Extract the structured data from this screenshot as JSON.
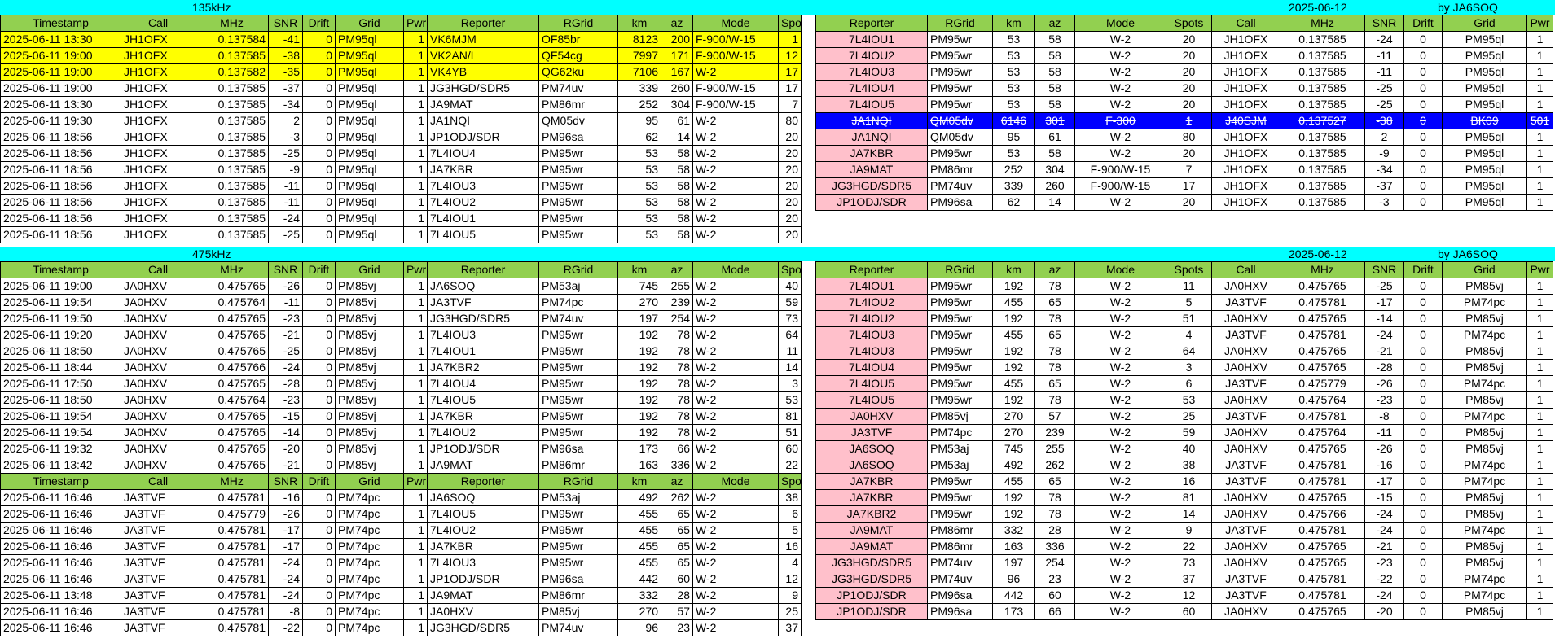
{
  "sections": {
    "s135": {
      "freq": "135kHz",
      "date": "2025-06-12",
      "by": "by JA6SOQ"
    },
    "s475": {
      "freq": "475kHz",
      "date": "2025-06-12",
      "by": "by JA6SOQ"
    }
  },
  "left_headers": [
    "Timestamp",
    "Call",
    "MHz",
    "SNR",
    "Drift",
    "Grid",
    "Pwr",
    "Reporter",
    "RGrid",
    "km",
    "az",
    "Mode",
    "Spots"
  ],
  "right_headers": [
    "Reporter",
    "RGrid",
    "km",
    "az",
    "Mode",
    "Spots",
    "Call",
    "MHz",
    "SNR",
    "Drift",
    "Grid",
    "Pwr"
  ],
  "colors": {
    "band": "#00ffff",
    "header": "#92d050",
    "highlight": "#ffff00",
    "reporter_pink": "#ffc0cb",
    "struck_row": "#0000ff"
  },
  "spots_135": [
    [
      "2025-06-11 13:30",
      "JH1OFX",
      "0.137584",
      "-41",
      "0",
      "PM95ql",
      "1",
      "VK6MJM",
      "OF85br",
      "8123",
      "200",
      "F-900/W-15",
      "1"
    ],
    [
      "2025-06-11 19:00",
      "JH1OFX",
      "0.137585",
      "-38",
      "0",
      "PM95ql",
      "1",
      "VK2AN/L",
      "QF54cg",
      "7997",
      "171",
      "F-900/W-15",
      "12"
    ],
    [
      "2025-06-11 19:00",
      "JH1OFX",
      "0.137582",
      "-35",
      "0",
      "PM95ql",
      "1",
      "VK4YB",
      "QG62ku",
      "7106",
      "167",
      "W-2",
      "17"
    ],
    [
      "2025-06-11 19:00",
      "JH1OFX",
      "0.137585",
      "-37",
      "0",
      "PM95ql",
      "1",
      "JG3HGD/SDR5",
      "PM74uv",
      "339",
      "260",
      "F-900/W-15",
      "17"
    ],
    [
      "2025-06-11 13:30",
      "JH1OFX",
      "0.137585",
      "-34",
      "0",
      "PM95ql",
      "1",
      "JA9MAT",
      "PM86mr",
      "252",
      "304",
      "F-900/W-15",
      "7"
    ],
    [
      "2025-06-11 19:30",
      "JH1OFX",
      "0.137585",
      "2",
      "0",
      "PM95ql",
      "1",
      "JA1NQI",
      "QM05dv",
      "95",
      "61",
      "W-2",
      "80"
    ],
    [
      "2025-06-11 18:56",
      "JH1OFX",
      "0.137585",
      "-3",
      "0",
      "PM95ql",
      "1",
      "JP1ODJ/SDR",
      "PM96sa",
      "62",
      "14",
      "W-2",
      "20"
    ],
    [
      "2025-06-11 18:56",
      "JH1OFX",
      "0.137585",
      "-25",
      "0",
      "PM95ql",
      "1",
      "7L4IOU4",
      "PM95wr",
      "53",
      "58",
      "W-2",
      "20"
    ],
    [
      "2025-06-11 18:56",
      "JH1OFX",
      "0.137585",
      "-9",
      "0",
      "PM95ql",
      "1",
      "JA7KBR",
      "PM95wr",
      "53",
      "58",
      "W-2",
      "20"
    ],
    [
      "2025-06-11 18:56",
      "JH1OFX",
      "0.137585",
      "-11",
      "0",
      "PM95ql",
      "1",
      "7L4IOU3",
      "PM95wr",
      "53",
      "58",
      "W-2",
      "20"
    ],
    [
      "2025-06-11 18:56",
      "JH1OFX",
      "0.137585",
      "-11",
      "0",
      "PM95ql",
      "1",
      "7L4IOU2",
      "PM95wr",
      "53",
      "58",
      "W-2",
      "20"
    ],
    [
      "2025-06-11 18:56",
      "JH1OFX",
      "0.137585",
      "-24",
      "0",
      "PM95ql",
      "1",
      "7L4IOU1",
      "PM95wr",
      "53",
      "58",
      "W-2",
      "20"
    ],
    [
      "2025-06-11 18:56",
      "JH1OFX",
      "0.137585",
      "-25",
      "0",
      "PM95ql",
      "1",
      "7L4IOU5",
      "PM95wr",
      "53",
      "58",
      "W-2",
      "20"
    ]
  ],
  "reporters_135": [
    [
      "7L4IOU1",
      "PM95wr",
      "53",
      "58",
      "W-2",
      "20",
      "JH1OFX",
      "0.137585",
      "-24",
      "0",
      "PM95ql",
      "1"
    ],
    [
      "7L4IOU2",
      "PM95wr",
      "53",
      "58",
      "W-2",
      "20",
      "JH1OFX",
      "0.137585",
      "-11",
      "0",
      "PM95ql",
      "1"
    ],
    [
      "7L4IOU3",
      "PM95wr",
      "53",
      "58",
      "W-2",
      "20",
      "JH1OFX",
      "0.137585",
      "-11",
      "0",
      "PM95ql",
      "1"
    ],
    [
      "7L4IOU4",
      "PM95wr",
      "53",
      "58",
      "W-2",
      "20",
      "JH1OFX",
      "0.137585",
      "-25",
      "0",
      "PM95ql",
      "1"
    ],
    [
      "7L4IOU5",
      "PM95wr",
      "53",
      "58",
      "W-2",
      "20",
      "JH1OFX",
      "0.137585",
      "-25",
      "0",
      "PM95ql",
      "1"
    ],
    [
      "JA1NQI",
      "QM05dv",
      "6146",
      "301",
      "F-300",
      "1",
      "J40SJM",
      "0.137527",
      "-38",
      "0",
      "BK09",
      "501"
    ],
    [
      "JA1NQI",
      "QM05dv",
      "95",
      "61",
      "W-2",
      "80",
      "JH1OFX",
      "0.137585",
      "2",
      "0",
      "PM95ql",
      "1"
    ],
    [
      "JA7KBR",
      "PM95wr",
      "53",
      "58",
      "W-2",
      "20",
      "JH1OFX",
      "0.137585",
      "-9",
      "0",
      "PM95ql",
      "1"
    ],
    [
      "JA9MAT",
      "PM86mr",
      "252",
      "304",
      "F-900/W-15",
      "7",
      "JH1OFX",
      "0.137585",
      "-34",
      "0",
      "PM95ql",
      "1"
    ],
    [
      "JG3HGD/SDR5",
      "PM74uv",
      "339",
      "260",
      "F-900/W-15",
      "17",
      "JH1OFX",
      "0.137585",
      "-37",
      "0",
      "PM95ql",
      "1"
    ],
    [
      "JP1ODJ/SDR",
      "PM96sa",
      "62",
      "14",
      "W-2",
      "20",
      "JH1OFX",
      "0.137585",
      "-3",
      "0",
      "PM95ql",
      "1"
    ]
  ],
  "spots_475_a": [
    [
      "2025-06-11 19:00",
      "JA0HXV",
      "0.475765",
      "-26",
      "0",
      "PM85vj",
      "1",
      "JA6SOQ",
      "PM53aj",
      "745",
      "255",
      "W-2",
      "40"
    ],
    [
      "2025-06-11 19:54",
      "JA0HXV",
      "0.475764",
      "-11",
      "0",
      "PM85vj",
      "1",
      "JA3TVF",
      "PM74pc",
      "270",
      "239",
      "W-2",
      "59"
    ],
    [
      "2025-06-11 19:50",
      "JA0HXV",
      "0.475765",
      "-23",
      "0",
      "PM85vj",
      "1",
      "JG3HGD/SDR5",
      "PM74uv",
      "197",
      "254",
      "W-2",
      "73"
    ],
    [
      "2025-06-11 19:20",
      "JA0HXV",
      "0.475765",
      "-21",
      "0",
      "PM85vj",
      "1",
      "7L4IOU3",
      "PM95wr",
      "192",
      "78",
      "W-2",
      "64"
    ],
    [
      "2025-06-11 18:50",
      "JA0HXV",
      "0.475765",
      "-25",
      "0",
      "PM85vj",
      "1",
      "7L4IOU1",
      "PM95wr",
      "192",
      "78",
      "W-2",
      "11"
    ],
    [
      "2025-06-11 18:44",
      "JA0HXV",
      "0.475766",
      "-24",
      "0",
      "PM85vj",
      "1",
      "JA7KBR2",
      "PM95wr",
      "192",
      "78",
      "W-2",
      "14"
    ],
    [
      "2025-06-11 17:50",
      "JA0HXV",
      "0.475765",
      "-28",
      "0",
      "PM85vj",
      "1",
      "7L4IOU4",
      "PM95wr",
      "192",
      "78",
      "W-2",
      "3"
    ],
    [
      "2025-06-11 18:50",
      "JA0HXV",
      "0.475764",
      "-23",
      "0",
      "PM85vj",
      "1",
      "7L4IOU5",
      "PM95wr",
      "192",
      "78",
      "W-2",
      "53"
    ],
    [
      "2025-06-11 19:54",
      "JA0HXV",
      "0.475765",
      "-15",
      "0",
      "PM85vj",
      "1",
      "JA7KBR",
      "PM95wr",
      "192",
      "78",
      "W-2",
      "81"
    ],
    [
      "2025-06-11 19:54",
      "JA0HXV",
      "0.475765",
      "-14",
      "0",
      "PM85vj",
      "1",
      "7L4IOU2",
      "PM95wr",
      "192",
      "78",
      "W-2",
      "51"
    ],
    [
      "2025-06-11 19:32",
      "JA0HXV",
      "0.475765",
      "-20",
      "0",
      "PM85vj",
      "1",
      "JP1ODJ/SDR",
      "PM96sa",
      "173",
      "66",
      "W-2",
      "60"
    ],
    [
      "2025-06-11 13:42",
      "JA0HXV",
      "0.475765",
      "-21",
      "0",
      "PM85vj",
      "1",
      "JA9MAT",
      "PM86mr",
      "163",
      "336",
      "W-2",
      "22"
    ]
  ],
  "spots_475_b": [
    [
      "2025-06-11 16:46",
      "JA3TVF",
      "0.475781",
      "-16",
      "0",
      "PM74pc",
      "1",
      "JA6SOQ",
      "PM53aj",
      "492",
      "262",
      "W-2",
      "38"
    ],
    [
      "2025-06-11 16:46",
      "JA3TVF",
      "0.475779",
      "-26",
      "0",
      "PM74pc",
      "1",
      "7L4IOU5",
      "PM95wr",
      "455",
      "65",
      "W-2",
      "6"
    ],
    [
      "2025-06-11 16:46",
      "JA3TVF",
      "0.475781",
      "-17",
      "0",
      "PM74pc",
      "1",
      "7L4IOU2",
      "PM95wr",
      "455",
      "65",
      "W-2",
      "5"
    ],
    [
      "2025-06-11 16:46",
      "JA3TVF",
      "0.475781",
      "-17",
      "0",
      "PM74pc",
      "1",
      "JA7KBR",
      "PM95wr",
      "455",
      "65",
      "W-2",
      "16"
    ],
    [
      "2025-06-11 16:46",
      "JA3TVF",
      "0.475781",
      "-24",
      "0",
      "PM74pc",
      "1",
      "7L4IOU3",
      "PM95wr",
      "455",
      "65",
      "W-2",
      "4"
    ],
    [
      "2025-06-11 16:46",
      "JA3TVF",
      "0.475781",
      "-24",
      "0",
      "PM74pc",
      "1",
      "JP1ODJ/SDR",
      "PM96sa",
      "442",
      "60",
      "W-2",
      "12"
    ],
    [
      "2025-06-11 13:48",
      "JA3TVF",
      "0.475781",
      "-24",
      "0",
      "PM74pc",
      "1",
      "JA9MAT",
      "PM86mr",
      "332",
      "28",
      "W-2",
      "9"
    ],
    [
      "2025-06-11 16:46",
      "JA3TVF",
      "0.475781",
      "-8",
      "0",
      "PM74pc",
      "1",
      "JA0HXV",
      "PM85vj",
      "270",
      "57",
      "W-2",
      "25"
    ],
    [
      "2025-06-11 16:46",
      "JA3TVF",
      "0.475781",
      "-22",
      "0",
      "PM74pc",
      "1",
      "JG3HGD/SDR5",
      "PM74uv",
      "96",
      "23",
      "W-2",
      "37"
    ]
  ],
  "reporters_475": [
    [
      "7L4IOU1",
      "PM95wr",
      "192",
      "78",
      "W-2",
      "11",
      "JA0HXV",
      "0.475765",
      "-25",
      "0",
      "PM85vj",
      "1"
    ],
    [
      "7L4IOU2",
      "PM95wr",
      "455",
      "65",
      "W-2",
      "5",
      "JA3TVF",
      "0.475781",
      "-17",
      "0",
      "PM74pc",
      "1"
    ],
    [
      "7L4IOU2",
      "PM95wr",
      "192",
      "78",
      "W-2",
      "51",
      "JA0HXV",
      "0.475765",
      "-14",
      "0",
      "PM85vj",
      "1"
    ],
    [
      "7L4IOU3",
      "PM95wr",
      "455",
      "65",
      "W-2",
      "4",
      "JA3TVF",
      "0.475781",
      "-24",
      "0",
      "PM74pc",
      "1"
    ],
    [
      "7L4IOU3",
      "PM95wr",
      "192",
      "78",
      "W-2",
      "64",
      "JA0HXV",
      "0.475765",
      "-21",
      "0",
      "PM85vj",
      "1"
    ],
    [
      "7L4IOU4",
      "PM95wr",
      "192",
      "78",
      "W-2",
      "3",
      "JA0HXV",
      "0.475765",
      "-28",
      "0",
      "PM85vj",
      "1"
    ],
    [
      "7L4IOU5",
      "PM95wr",
      "455",
      "65",
      "W-2",
      "6",
      "JA3TVF",
      "0.475779",
      "-26",
      "0",
      "PM74pc",
      "1"
    ],
    [
      "7L4IOU5",
      "PM95wr",
      "192",
      "78",
      "W-2",
      "53",
      "JA0HXV",
      "0.475764",
      "-23",
      "0",
      "PM85vj",
      "1"
    ],
    [
      "JA0HXV",
      "PM85vj",
      "270",
      "57",
      "W-2",
      "25",
      "JA3TVF",
      "0.475781",
      "-8",
      "0",
      "PM74pc",
      "1"
    ],
    [
      "JA3TVF",
      "PM74pc",
      "270",
      "239",
      "W-2",
      "59",
      "JA0HXV",
      "0.475764",
      "-11",
      "0",
      "PM85vj",
      "1"
    ],
    [
      "JA6SOQ",
      "PM53aj",
      "745",
      "255",
      "W-2",
      "40",
      "JA0HXV",
      "0.475765",
      "-26",
      "0",
      "PM85vj",
      "1"
    ],
    [
      "JA6SOQ",
      "PM53aj",
      "492",
      "262",
      "W-2",
      "38",
      "JA3TVF",
      "0.475781",
      "-16",
      "0",
      "PM74pc",
      "1"
    ],
    [
      "JA7KBR",
      "PM95wr",
      "455",
      "65",
      "W-2",
      "16",
      "JA3TVF",
      "0.475781",
      "-17",
      "0",
      "PM74pc",
      "1"
    ],
    [
      "JA7KBR",
      "PM95wr",
      "192",
      "78",
      "W-2",
      "81",
      "JA0HXV",
      "0.475765",
      "-15",
      "0",
      "PM85vj",
      "1"
    ],
    [
      "JA7KBR2",
      "PM95wr",
      "192",
      "78",
      "W-2",
      "14",
      "JA0HXV",
      "0.475766",
      "-24",
      "0",
      "PM85vj",
      "1"
    ],
    [
      "JA9MAT",
      "PM86mr",
      "332",
      "28",
      "W-2",
      "9",
      "JA3TVF",
      "0.475781",
      "-24",
      "0",
      "PM74pc",
      "1"
    ],
    [
      "JA9MAT",
      "PM86mr",
      "163",
      "336",
      "W-2",
      "22",
      "JA0HXV",
      "0.475765",
      "-21",
      "0",
      "PM85vj",
      "1"
    ],
    [
      "JG3HGD/SDR5",
      "PM74uv",
      "197",
      "254",
      "W-2",
      "73",
      "JA0HXV",
      "0.475765",
      "-23",
      "0",
      "PM85vj",
      "1"
    ],
    [
      "JG3HGD/SDR5",
      "PM74uv",
      "96",
      "23",
      "W-2",
      "37",
      "JA3TVF",
      "0.475781",
      "-22",
      "0",
      "PM74pc",
      "1"
    ],
    [
      "JP1ODJ/SDR",
      "PM96sa",
      "442",
      "60",
      "W-2",
      "12",
      "JA3TVF",
      "0.475781",
      "-24",
      "0",
      "PM74pc",
      "1"
    ],
    [
      "JP1ODJ/SDR",
      "PM96sa",
      "173",
      "66",
      "W-2",
      "60",
      "JA0HXV",
      "0.475765",
      "-20",
      "0",
      "PM85vj",
      "1"
    ]
  ]
}
